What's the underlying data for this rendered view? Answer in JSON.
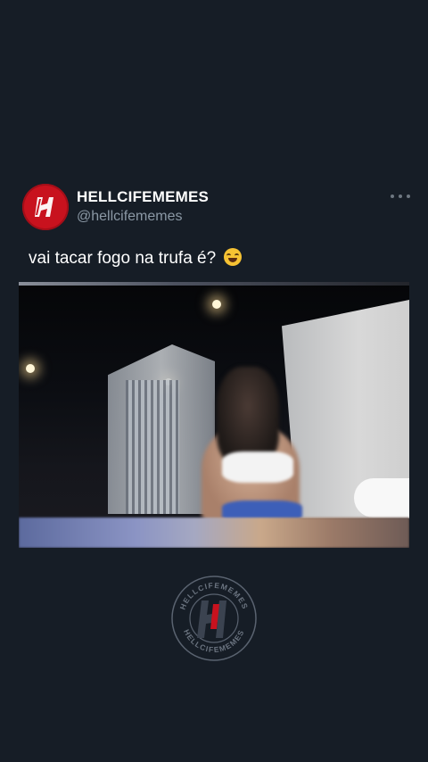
{
  "post": {
    "display_name": "HELLCIFEMEMES",
    "handle": "@hellcifememes",
    "text": "vai tacar fogo na trufa é?",
    "emoji_name": "face-with-tears-of-joy-icon",
    "avatar_icon": "hellcife-logo-icon",
    "more_icon": "more-options-icon"
  },
  "watermark": {
    "ring_text": "HELLCIFEMEMES",
    "icon": "hellcife-watermark-icon"
  },
  "colors": {
    "background": "#161d26",
    "brand_red": "#c8121e",
    "handle_gray": "#8b98a5"
  }
}
